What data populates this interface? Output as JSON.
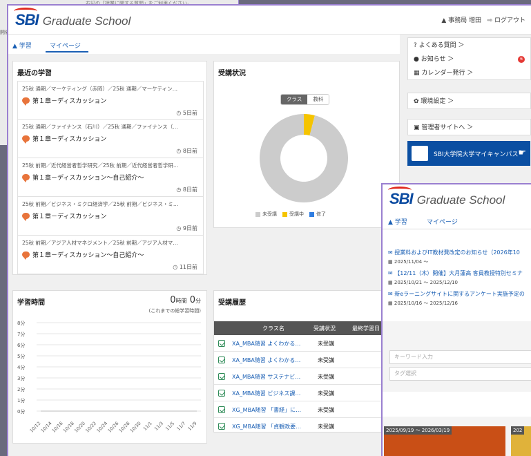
{
  "background_window": {
    "text": "右記の「授業に関する質問」をご利用ください。",
    "side_label": "開催"
  },
  "header": {
    "logo_text": "SBI",
    "logo_sub": "Graduate School",
    "user": "▲ 事務局 増田",
    "logout": "ログアウト"
  },
  "tabs": [
    {
      "label": "学習",
      "active": false
    },
    {
      "label": "マイページ",
      "active": true
    }
  ],
  "recent": {
    "title": "最近の学習",
    "items": [
      {
        "path": "25秋 通期／マーケティング（赤岡）／25秋 通期／マーケティン…",
        "title": "第１章－ディスカッション",
        "time": "5日前"
      },
      {
        "path": "25秋 通期／ファイナンス（石川）／25秋 通期／ファイナンス（…",
        "title": "第１章－ディスカッション",
        "time": "8日前"
      },
      {
        "path": "25秋 前期／近代経営者哲学研究／25秋 前期／近代経営者哲学研…",
        "title": "第１章－ディスカッション～自己紹介～",
        "time": "8日前"
      },
      {
        "path": "25秋 前期／ビジネス・ミクロ経済学／25秋 前期／ビジネス・ミ…",
        "title": "第１章－ディスカッション",
        "time": "9日前"
      },
      {
        "path": "25秋 前期／アジア人材マネジメント／25秋 前期／アジア人材マ…",
        "title": "第１章－ディスカッション～自己紹介～",
        "time": "11日前"
      }
    ]
  },
  "status": {
    "title": "受講状況",
    "toggle": [
      "クラス",
      "教科"
    ],
    "legend": [
      "未受講",
      "受講中",
      "修了"
    ],
    "colors": {
      "not_started": "#cccccc",
      "in_progress": "#f5c400",
      "completed": "#2f7de1"
    }
  },
  "study_time": {
    "title": "学習時間",
    "hours": "0",
    "hours_unit": "時間",
    "minutes": "0",
    "minutes_unit": "分",
    "note": "(これまでの総学習時間)"
  },
  "chart_data": [
    {
      "type": "pie",
      "title": "",
      "categories": [
        "未受講",
        "受講中",
        "修了"
      ],
      "values": [
        96,
        4,
        0
      ]
    },
    {
      "type": "line",
      "title": "",
      "x": [
        "10/12",
        "10/14",
        "10/16",
        "10/18",
        "10/20",
        "10/22",
        "10/24",
        "10/26",
        "10/28",
        "10/30",
        "11/1",
        "11/3",
        "11/5",
        "11/7",
        "11/9"
      ],
      "y_ticks": [
        "8分",
        "7分",
        "6分",
        "5分",
        "4分",
        "3分",
        "2分",
        "1分",
        "0分"
      ],
      "ylim": [
        0,
        8
      ],
      "series": [
        {
          "values": [
            0,
            0,
            0,
            0,
            0,
            0,
            0,
            0,
            0,
            0,
            0,
            0,
            0,
            0,
            0
          ]
        }
      ]
    }
  ],
  "history": {
    "title": "受講履歴",
    "columns": [
      "クラス名",
      "受講状況",
      "最終学習日"
    ],
    "rows": [
      {
        "name": "XA_MBA随習 よくわかる…",
        "status": "未受講"
      },
      {
        "name": "XA_MBA随習 よくわかる…",
        "status": "未受講"
      },
      {
        "name": "XA_MBA随習 サステナビ…",
        "status": "未受講"
      },
      {
        "name": "XA_MBA随習 ビジネス課…",
        "status": "未受講"
      },
      {
        "name": "XG_MBA随習 「書経」に…",
        "status": "未受講"
      },
      {
        "name": "XG_MBA随習 「貞観政要…",
        "status": "未受講"
      }
    ]
  },
  "sidebar": {
    "faq": "よくある質問 ＞",
    "news": "お知らせ ＞",
    "news_badge": "6",
    "calendar": "カレンダー発行 ＞",
    "settings": "環境設定 ＞",
    "admin": "管理者サイトへ ＞",
    "campus": "SBI大学院大学マイキャンパス"
  },
  "front_window": {
    "logo_text": "SBI",
    "logo_sub": "Graduate School",
    "tabs": [
      "学習",
      "マイページ"
    ],
    "news": [
      {
        "title": "授業料およびIT教材費改定のお知らせ（2026年10",
        "date": "2025/11/04 ～"
      },
      {
        "title": "【12/11（木）開催】大月蓮高 客員教授特別セミナ",
        "date": "2025/10/21 ～ 2025/12/10"
      },
      {
        "title": "新eラーニングサイトに関するアンケート実施予定の",
        "date": "2025/10/16 ～ 2025/12/16"
      }
    ],
    "keyword_placeholder": "キーワード入力",
    "tag_placeholder": "タグ選択",
    "course_dates": [
      "2025/09/19 ～ 2026/03/19",
      "202"
    ],
    "course_colors": [
      "#c94f16",
      "#e0b23a"
    ]
  }
}
